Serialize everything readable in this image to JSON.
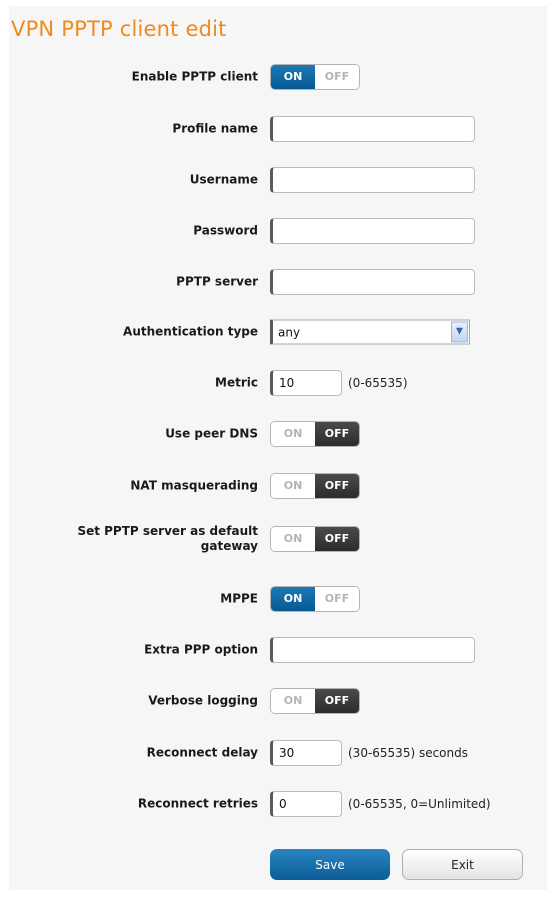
{
  "title": "VPN PPTP client edit",
  "fields": {
    "enable": {
      "label": "Enable PPTP client",
      "on": "ON",
      "off": "OFF",
      "state": "on"
    },
    "profile_name": {
      "label": "Profile name",
      "value": ""
    },
    "username": {
      "label": "Username",
      "value": ""
    },
    "password": {
      "label": "Password",
      "value": ""
    },
    "pptp_server": {
      "label": "PPTP server",
      "value": ""
    },
    "auth_type": {
      "label": "Authentication type",
      "value": "any"
    },
    "metric": {
      "label": "Metric",
      "value": "10",
      "hint": "(0-65535)"
    },
    "peer_dns": {
      "label": "Use peer DNS",
      "on": "ON",
      "off": "OFF",
      "state": "off"
    },
    "nat": {
      "label": "NAT masquerading",
      "on": "ON",
      "off": "OFF",
      "state": "off"
    },
    "default_gw": {
      "label": "Set PPTP server as default gateway",
      "on": "ON",
      "off": "OFF",
      "state": "off"
    },
    "mppe": {
      "label": "MPPE",
      "on": "ON",
      "off": "OFF",
      "state": "on"
    },
    "extra_ppp": {
      "label": "Extra PPP option",
      "value": ""
    },
    "verbose": {
      "label": "Verbose logging",
      "on": "ON",
      "off": "OFF",
      "state": "off"
    },
    "reconnect_delay": {
      "label": "Reconnect delay",
      "value": "30",
      "hint": "(30-65535) seconds"
    },
    "reconnect_retries": {
      "label": "Reconnect retries",
      "value": "0",
      "hint": "(0-65535, 0=Unlimited)"
    }
  },
  "buttons": {
    "save": "Save",
    "exit": "Exit"
  },
  "colors": {
    "accent": "#f08a1c",
    "toggle_on": "#0b6aa8",
    "toggle_off": "#3a3a3a"
  }
}
